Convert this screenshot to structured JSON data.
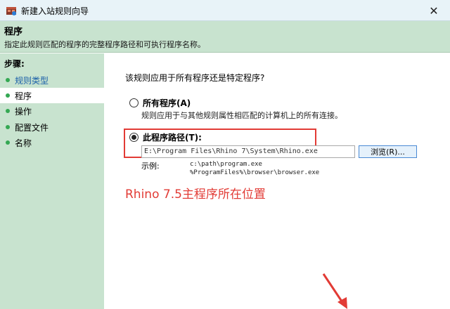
{
  "window": {
    "title": "新建入站规则向导",
    "close_label": "✕"
  },
  "header": {
    "title": "程序",
    "description": "指定此规则匹配的程序的完整程序路径和可执行程序名称。"
  },
  "sidebar": {
    "heading": "步骤:",
    "items": [
      {
        "label": "规则类型"
      },
      {
        "label": "程序"
      },
      {
        "label": "操作"
      },
      {
        "label": "配置文件"
      },
      {
        "label": "名称"
      }
    ]
  },
  "main": {
    "question": "该规则应用于所有程序还是特定程序?",
    "all_programs": {
      "label": "所有程序(A)",
      "description": "规则应用于与其他规则属性相匹配的计算机上的所有连接。"
    },
    "program_path": {
      "label": "此程序路径(T):",
      "value": "E:\\Program Files\\Rhino 7\\System\\Rhino.exe"
    },
    "browse_label": "浏览(R)...",
    "example_label": "示例:",
    "examples": [
      "c:\\path\\program.exe",
      "%ProgramFiles%\\browser\\browser.exe"
    ]
  },
  "annotation": {
    "text": "Rhino 7.5主程序所在位置"
  },
  "colors": {
    "accent_red": "#e23b35",
    "sidebar_green": "#c8e3cf",
    "bullet_green": "#34a853"
  }
}
